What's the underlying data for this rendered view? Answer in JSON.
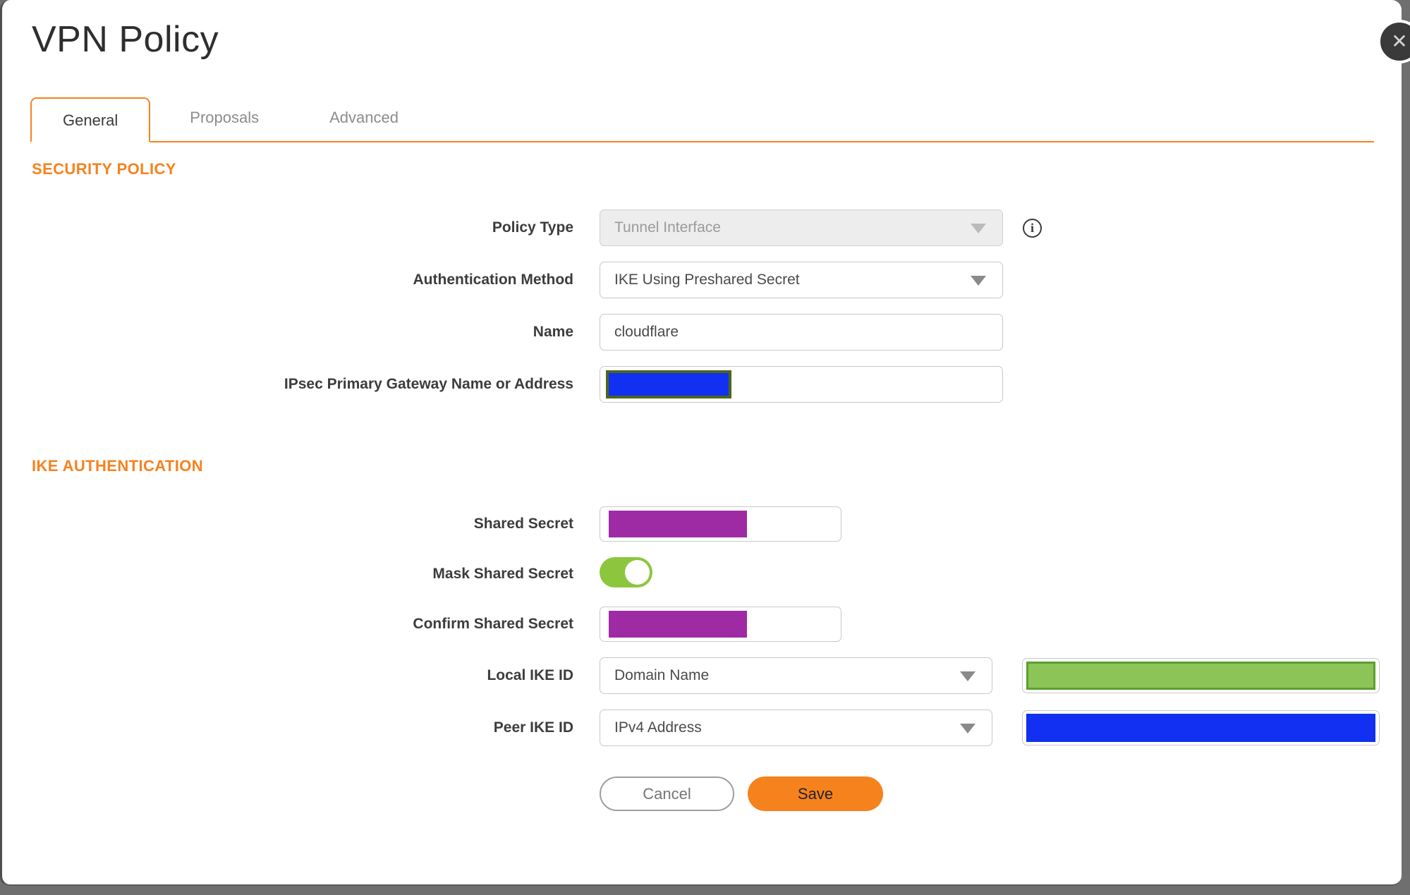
{
  "dialog": {
    "title": "VPN Policy"
  },
  "tabs": [
    {
      "label": "General",
      "active": true
    },
    {
      "label": "Proposals",
      "active": false
    },
    {
      "label": "Advanced",
      "active": false
    }
  ],
  "security_policy": {
    "heading": "SECURITY POLICY",
    "policy_type": {
      "label": "Policy Type",
      "value": "Tunnel Interface",
      "disabled": true
    },
    "auth_method": {
      "label": "Authentication Method",
      "value": "IKE Using Preshared Secret"
    },
    "name": {
      "label": "Name",
      "value": "cloudflare"
    },
    "gateway": {
      "label": "IPsec Primary Gateway Name or Address",
      "value_redacted": true
    }
  },
  "ike_authentication": {
    "heading": "IKE AUTHENTICATION",
    "shared_secret": {
      "label": "Shared Secret",
      "value_redacted": true
    },
    "mask_shared_secret": {
      "label": "Mask Shared Secret",
      "enabled": true
    },
    "confirm_shared_secret": {
      "label": "Confirm Shared Secret",
      "value_redacted": true
    },
    "local_ike_id": {
      "label": "Local IKE ID",
      "type_value": "Domain Name",
      "value_redacted": true
    },
    "peer_ike_id": {
      "label": "Peer IKE ID",
      "type_value": "IPv4 Address",
      "value_redacted": true
    }
  },
  "buttons": {
    "cancel": "Cancel",
    "save": "Save"
  },
  "icons": {
    "close": "✕",
    "info": "i"
  },
  "colors": {
    "accent_orange": "#F6821E",
    "toggle_green": "#8CC63E",
    "redaction_purple": "#9E2BA4",
    "redaction_blue": "#1130F1",
    "redaction_olive_border": "#4A661D",
    "redaction_green_fill": "#8DC457",
    "redaction_green_border": "#5C9F31",
    "backdrop_gray": "#6F6F6F"
  }
}
